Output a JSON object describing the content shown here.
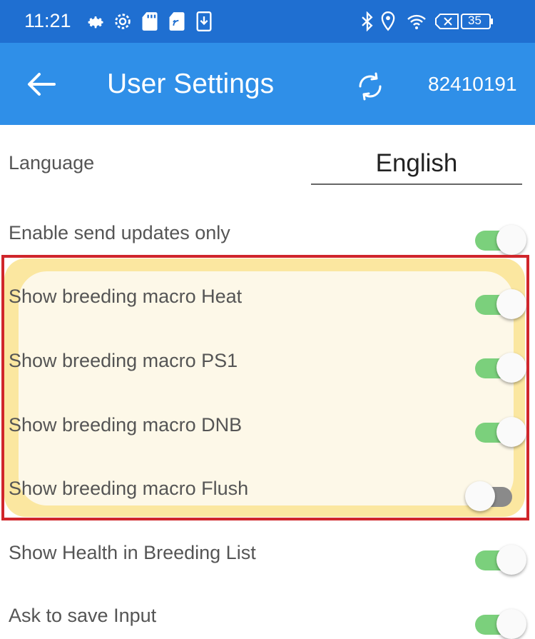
{
  "status_bar": {
    "time": "11:21",
    "battery": "35",
    "icons": [
      "settings-icon",
      "settings-icon",
      "sd-card-icon",
      "sim-card-icon",
      "download-icon",
      "bluetooth-icon",
      "location-icon",
      "wifi-icon",
      "no-sim-icon",
      "battery-icon"
    ]
  },
  "app_bar": {
    "title": "User Settings",
    "user_id": "82410191",
    "back_icon": "arrow-left-icon",
    "sync_icon": "sync-icon"
  },
  "settings": {
    "language": {
      "label": "Language",
      "value": "English"
    },
    "toggles": [
      {
        "label": "Enable send updates only",
        "on": true
      },
      {
        "label": "Show breeding macro Heat",
        "on": true
      },
      {
        "label": "Show breeding macro PS1",
        "on": true
      },
      {
        "label": "Show breeding macro DNB",
        "on": true
      },
      {
        "label": "Show breeding macro Flush",
        "on": false
      },
      {
        "label": "Show Health in Breeding List",
        "on": true
      },
      {
        "label": "Ask to save Input",
        "on": true
      }
    ]
  },
  "colors": {
    "status_bar": "#1f6fd1",
    "app_bar": "#2f8fe8",
    "toggle_on": "#7bd07c",
    "toggle_off": "#8a8a8a",
    "annotation_box": "#d0262b",
    "annotation_highlight": "#fbe7a0"
  }
}
